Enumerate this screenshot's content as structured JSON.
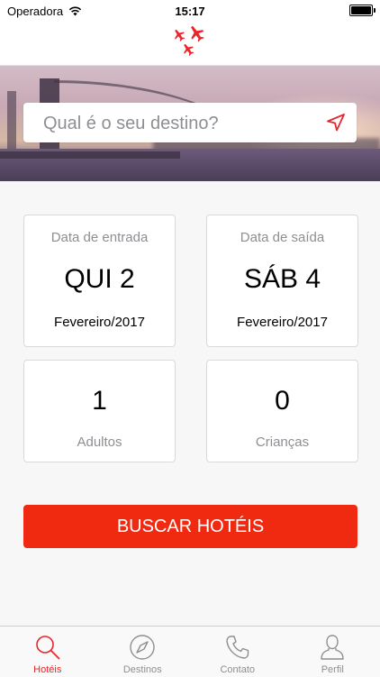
{
  "status_bar": {
    "carrier": "Operadora",
    "time": "15:17"
  },
  "search": {
    "placeholder": "Qual é o seu destino?"
  },
  "checkin": {
    "caption": "Data de entrada",
    "day": "QUI 2",
    "month": "Fevereiro/2017"
  },
  "checkout": {
    "caption": "Data de saída",
    "day": "SÁB 4",
    "month": "Fevereiro/2017"
  },
  "adults": {
    "count": "1",
    "caption": "Adultos"
  },
  "children": {
    "count": "0",
    "caption": "Crianças"
  },
  "search_button": {
    "label": "BUSCAR HOTÉIS"
  },
  "tabs": [
    {
      "label": "Hotéis",
      "icon": "search-icon",
      "active": true
    },
    {
      "label": "Destinos",
      "icon": "compass-icon",
      "active": false
    },
    {
      "label": "Contato",
      "icon": "phone-icon",
      "active": false
    },
    {
      "label": "Perfil",
      "icon": "person-icon",
      "active": false
    }
  ],
  "colors": {
    "accent": "#f02a10",
    "tab_active": "#e8262b",
    "tab_inactive": "#8e8e93"
  }
}
